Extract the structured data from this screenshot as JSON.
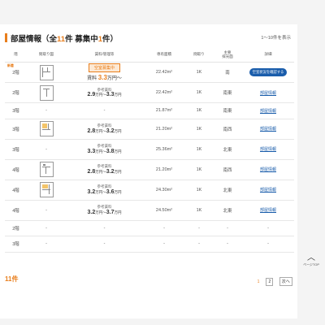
{
  "header": {
    "title_prefix": "部屋情報（全",
    "total_count": "11",
    "title_mid": "件 募集中",
    "vacant_count": "1",
    "title_suffix": "件）",
    "range_label": "1～10件を表示"
  },
  "table": {
    "columns": [
      "階",
      "間取り図",
      "賃料/管理等",
      "専有面積",
      "間取り",
      "主要\n採光面",
      "詳細"
    ],
    "rows": [
      {
        "floor": "2階",
        "new_badge": "新着",
        "new_badge_sub": "空室",
        "plan": "plan-a",
        "status_label": "空室募集中",
        "rent_prefix": "賃料",
        "rent_amount": "3.3",
        "rent_unit": "万円～",
        "area": "22.42m²",
        "layout": "1K",
        "light": "南",
        "detail": "空室状況を確認する"
      },
      {
        "floor": "2階",
        "plan": "plan-b",
        "ref_label": "参考賃料",
        "range_min": "2.9",
        "range_max": "3.3",
        "area": "22.42m²",
        "layout": "1K",
        "light": "南東",
        "detail": "部屋情報"
      },
      {
        "floor": "3階",
        "plan": "-",
        "ref_label": "",
        "rent_dash": "-",
        "area": "21.87m²",
        "layout": "1K",
        "light": "南東",
        "detail": "部屋情報"
      },
      {
        "floor": "3階",
        "plan": "plan-c",
        "ref_label": "参考賃料",
        "range_min": "2.8",
        "range_max": "3.2",
        "area": "21.20m²",
        "layout": "1K",
        "light": "南西",
        "detail": "部屋情報"
      },
      {
        "floor": "3階",
        "plan": "-",
        "ref_label": "参考賃料",
        "range_min": "3.3",
        "range_max": "3.8",
        "area": "25.36m²",
        "layout": "1K",
        "light": "北東",
        "detail": "部屋情報"
      },
      {
        "floor": "4階",
        "plan": "plan-d",
        "ref_label": "参考賃料",
        "range_min": "2.8",
        "range_max": "3.2",
        "area": "21.20m²",
        "layout": "1K",
        "light": "南西",
        "detail": "部屋情報"
      },
      {
        "floor": "4階",
        "plan": "plan-e",
        "ref_label": "参考賃料",
        "range_min": "3.2",
        "range_max": "3.6",
        "area": "24.30m²",
        "layout": "1K",
        "light": "北東",
        "detail": "部屋情報"
      },
      {
        "floor": "4階",
        "plan": "-",
        "ref_label": "参考賃料",
        "range_min": "3.2",
        "range_max": "3.7",
        "area": "24.50m²",
        "layout": "1K",
        "light": "北東",
        "detail": "部屋情報"
      },
      {
        "floor": "2階",
        "plan": "-",
        "rent_dash": "-",
        "area": "-",
        "layout": "-",
        "light": "-",
        "detail": "-"
      },
      {
        "floor": "3階",
        "plan": "-",
        "rent_dash": "-",
        "area": "-",
        "layout": "-",
        "light": "-",
        "detail": "-"
      }
    ],
    "unit_man": "万円",
    "tilde": "～"
  },
  "footer": {
    "count_label": "11件",
    "pages": [
      "1",
      "2"
    ],
    "next_label": "次へ"
  },
  "pagetop": {
    "arrow": "︿",
    "label": "ページTOP"
  },
  "colors": {
    "accent": "#e87e1c",
    "link": "#1a5dab"
  }
}
